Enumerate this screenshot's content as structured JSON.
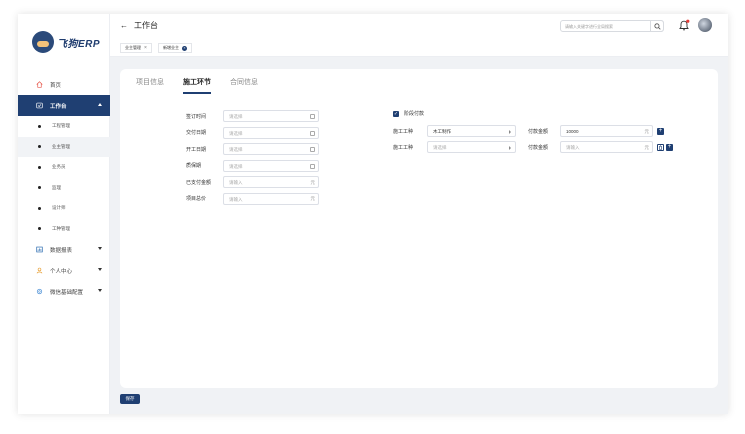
{
  "brand": {
    "name": "飞狗ERP"
  },
  "sidebar": {
    "items": [
      {
        "label": "首页"
      },
      {
        "label": "工作台"
      },
      {
        "label": "数据报表"
      },
      {
        "label": "个人中心"
      },
      {
        "label": "微信基础配置"
      }
    ],
    "sub_items": [
      {
        "label": "工程管理"
      },
      {
        "label": "业主管理"
      },
      {
        "label": "业务员"
      },
      {
        "label": "监理"
      },
      {
        "label": "设计师"
      },
      {
        "label": "工种管理"
      }
    ]
  },
  "header": {
    "back_glyph": "←",
    "title": "工作台",
    "search_placeholder": "请输入关键字进行全局搜索"
  },
  "tags": [
    {
      "label": "业主管理",
      "close": "×"
    },
    {
      "label": "新增业主",
      "close": "×"
    }
  ],
  "tabs": [
    {
      "label": "项目信息"
    },
    {
      "label": "施工环节"
    },
    {
      "label": "合同信息"
    }
  ],
  "form": {
    "fields": [
      {
        "label": "签订时间",
        "placeholder": "请选择",
        "kind": "date"
      },
      {
        "label": "交付日期",
        "placeholder": "请选择",
        "kind": "date"
      },
      {
        "label": "开工日期",
        "placeholder": "请选择",
        "kind": "date"
      },
      {
        "label": "质保期",
        "placeholder": "请选择",
        "kind": "date"
      },
      {
        "label": "已支付金额",
        "placeholder": "请输入",
        "suffix": "元"
      },
      {
        "label": "项目总价",
        "placeholder": "请输入",
        "suffix": "元"
      }
    ]
  },
  "payment": {
    "checkbox_label": "阶段付款",
    "checked": true,
    "rows": [
      {
        "type_label": "施工工种",
        "type_value": "木工制作",
        "amount_label": "付款金额",
        "amount_value": "10000",
        "suffix": "元"
      },
      {
        "type_label": "施工工种",
        "type_value": "请选择",
        "amount_label": "付款金额",
        "amount_value": "请输入",
        "suffix": "元"
      }
    ]
  },
  "actions": {
    "save_label": "保存"
  },
  "colors": {
    "primary": "#1f3f72",
    "background": "#f0f2f5"
  }
}
